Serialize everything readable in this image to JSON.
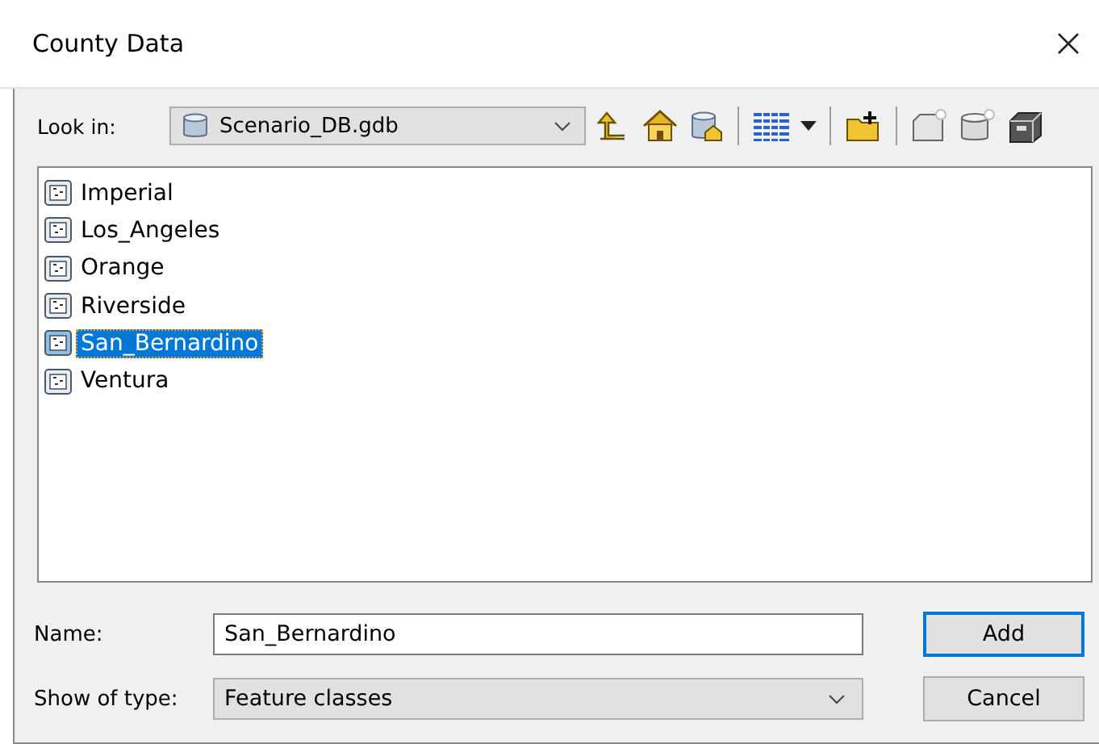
{
  "window": {
    "title": "County Data"
  },
  "look_in": {
    "label": "Look in:",
    "value": "Scenario_DB.gdb"
  },
  "items": [
    {
      "label": "Imperial",
      "selected": false
    },
    {
      "label": "Los_Angeles",
      "selected": false
    },
    {
      "label": "Orange",
      "selected": false
    },
    {
      "label": "Riverside",
      "selected": false
    },
    {
      "label": "San_Bernardino",
      "selected": true
    },
    {
      "label": "Ventura",
      "selected": false
    }
  ],
  "name_field": {
    "label": "Name:",
    "value": "San_Bernardino"
  },
  "type_field": {
    "label": "Show of type:",
    "value": "Feature classes"
  },
  "buttons": [
    {
      "label": "Add",
      "default": true
    },
    {
      "label": "Cancel",
      "default": false
    }
  ]
}
